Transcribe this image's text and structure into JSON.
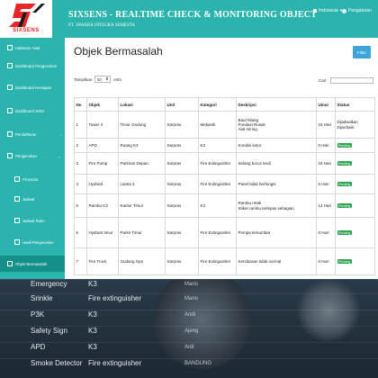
{
  "app": {
    "logo_text": "SIXSENS",
    "title": "SIXSENS - REALTIME CHECK & MONITORING OBJECT",
    "subtitle": "PT. JAWARA INTEGRA SEMESTA",
    "language": "Indonesia",
    "user": "Pengaturan",
    "colors": {
      "primary": "#2bb3ad",
      "active": "#148f89",
      "badge": "#2da44e",
      "filter_button": "#3da5d9",
      "logo": "#e8262a"
    }
  },
  "sidebar": {
    "items": [
      {
        "label": "Halaman Awal",
        "icon": "home-icon"
      },
      {
        "label": "Dashboard Pengecekan",
        "icon": "dashboard-icon"
      },
      {
        "label": "Dashboard Kesiapan",
        "icon": "dashboard-icon"
      },
      {
        "label": "Dashboard SDM",
        "icon": "dashboard-icon"
      },
      {
        "label": "Pendaftaran",
        "icon": "edit-icon"
      },
      {
        "label": "Pengecekan",
        "icon": "check-icon"
      },
      {
        "label": "Prosedur",
        "icon": "document-icon"
      },
      {
        "label": "Jadwal",
        "icon": "calendar-icon"
      },
      {
        "label": "Jadwal Rutin",
        "icon": "calendar-icon"
      },
      {
        "label": "Hasil Pengecekan",
        "icon": "list-icon"
      },
      {
        "label": "Objek Bermasalah",
        "icon": "warning-icon"
      }
    ]
  },
  "main": {
    "page_title": "Objek Bermasalah",
    "filter_label": "Filter",
    "length_prefix": "Tampilkan",
    "length_value": "10",
    "length_suffix": "entri",
    "search_label": "Cari:",
    "search_value": "",
    "columns": [
      "No",
      "Objek",
      "Lokasi",
      "Unit",
      "Kategori",
      "Deskripsi",
      "Umur",
      "Status"
    ],
    "rows": [
      {
        "no": "1",
        "objek": "Tower 4",
        "lokasi": "Timur Gedung",
        "unit": "Sarpras",
        "kategori": "Mekanik",
        "deskripsi": [
          "Baut hilang",
          "Pondasi Rusak",
          "Alat miring"
        ],
        "umur": "16 Hari",
        "status": "Diperbaiki",
        "status_prefix": "Dijadwalkan"
      },
      {
        "no": "2",
        "objek": "APD",
        "lokasi": "Ruang K3",
        "unit": "Sarpras",
        "kategori": "K3",
        "deskripsi": [
          "Kondisi kotor"
        ],
        "umur": "0 Hari",
        "status": "Pending"
      },
      {
        "no": "3",
        "objek": "Fire Pump",
        "lokasi": "Parkiran Depan",
        "unit": "Sarpras",
        "kategori": "Fire Extinguisher",
        "deskripsi": [
          "Selang bocor kecil"
        ],
        "umur": "16 Hari",
        "status": "Pending"
      },
      {
        "no": "4",
        "objek": "Hydrant",
        "lokasi": "Lantai 2",
        "unit": "Sarpras",
        "kategori": "Fire Extinguisher",
        "deskripsi": [
          "Panel tidak berfungsi"
        ],
        "umur": "5 Hari",
        "status": "Pending"
      },
      {
        "no": "5",
        "objek": "Rambu K3",
        "lokasi": "Kantor Timur",
        "unit": "Sarpras",
        "kategori": "K3",
        "deskripsi": [
          "Rambu retak",
          "Stiker rambu terlepas sebagian"
        ],
        "umur": "14 Hari",
        "status": "Pending"
      },
      {
        "no": "6",
        "objek": "Hydrant timur",
        "lokasi": "Parkir Timur",
        "unit": "Sarpras",
        "kategori": "Fire Extinguisher",
        "deskripsi": [
          "Pompa tersumbat"
        ],
        "umur": "0 Hari",
        "status": "Pending"
      },
      {
        "no": "7",
        "objek": "Fire Truck",
        "lokasi": "Gudang Ops",
        "unit": "Sarpras",
        "kategori": "Fire Extinguisher",
        "deskripsi": [
          "Kendaraan tidak normal"
        ],
        "umur": "0 Hari",
        "status": "Pending"
      }
    ]
  },
  "background": {
    "rows": [
      {
        "c1": "Emergency",
        "c2": "K3",
        "c3": "Mario"
      },
      {
        "c1": "Srinkle",
        "c2": "Fire extinguisher",
        "c3": "Mario"
      },
      {
        "c1": "P3K",
        "c2": "K3",
        "c3": "Andi"
      },
      {
        "c1": "Safety Sign",
        "c2": "K3",
        "c3": "Ajeng"
      },
      {
        "c1": "APD",
        "c2": "K3",
        "c3": "Ardi"
      },
      {
        "c1": "Smoke Detector",
        "c2": "Fire extinguisher",
        "c3": "BANDUNG"
      }
    ]
  }
}
